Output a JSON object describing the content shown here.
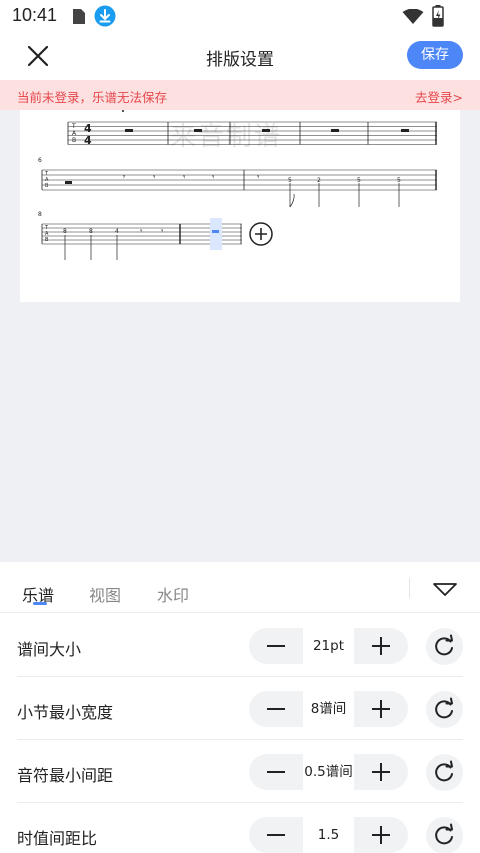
{
  "status_bar": {
    "time": "10:41"
  },
  "header": {
    "title": "排版设置",
    "save_label": "保存"
  },
  "warning": {
    "text": "当前未登录，乐谱无法保存",
    "link": "去登录>"
  },
  "score": {
    "watermark": "来音制谱",
    "tab_label": [
      "T",
      "A",
      "B"
    ],
    "time_signature": [
      "4",
      "4"
    ],
    "measure_numbers": [
      "6",
      "8"
    ],
    "line2_frets": [
      "5",
      "2",
      "5",
      "5"
    ],
    "line3_frets": [
      "8",
      "8",
      "4"
    ]
  },
  "panel": {
    "tabs": [
      {
        "label": "乐谱",
        "active": true
      },
      {
        "label": "视图",
        "active": false
      },
      {
        "label": "水印",
        "active": false
      }
    ],
    "rows": [
      {
        "label": "谱间大小",
        "value": "21pt"
      },
      {
        "label": "小节最小宽度",
        "value": "8谱间"
      },
      {
        "label": "音符最小间距",
        "value": "0.5谱间"
      },
      {
        "label": "时值间距比",
        "value": "1.5"
      }
    ]
  },
  "colors": {
    "accent": "#4d86f7",
    "warning_bg": "#fde0e0",
    "warning_text": "#e5484d"
  }
}
